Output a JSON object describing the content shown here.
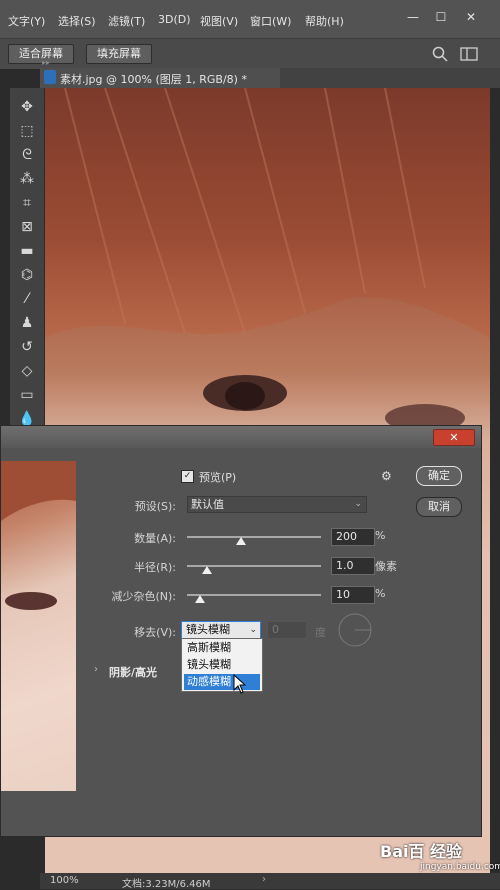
{
  "menu": [
    "文字(Y)",
    "选择(S)",
    "滤镜(T)",
    "3D(D)",
    "视图(V)",
    "窗口(W)",
    "帮助(H)"
  ],
  "window_controls": {
    "minimize": "—",
    "restore": "☐",
    "close": "✕"
  },
  "options_bar": {
    "fit_screen": "适合屏幕",
    "fill_screen": "填充屏幕"
  },
  "document_tab": {
    "title": "素材.jpg @ 100% (图层 1, RGB/8) *",
    "close": "×"
  },
  "dialog": {
    "preview_label": "预览(P)",
    "preview_checked": true,
    "ok_button": "确定",
    "cancel_button": "取消",
    "preset_label": "预设(S):",
    "preset_value": "默认值",
    "amount_label": "数量(A):",
    "amount_value": "200",
    "amount_unit": "%",
    "amount_fraction": 0.4,
    "radius_label": "半径(R):",
    "radius_value": "1.0",
    "radius_unit": "像素",
    "radius_fraction": 0.15,
    "noise_label": "减少杂色(N):",
    "noise_value": "10",
    "noise_unit": "%",
    "noise_fraction": 0.1,
    "remove_label": "移去(V):",
    "remove_value": "镜头模糊",
    "angle_value": "0",
    "angle_unit": "度",
    "shadow_section": "阴影/高光",
    "dropdown_options": [
      "高斯模糊",
      "镜头模糊",
      "动感模糊"
    ],
    "dropdown_highlighted": "动感模糊"
  },
  "status": {
    "zoom": "100%",
    "doc_info": "文档:3.23M/6.46M"
  },
  "watermark": {
    "text": "Bai百 经验",
    "url": "jingyan.baidu.com"
  },
  "colors": {
    "accent_blue": "#2f7fd6",
    "panel_gray": "#535353"
  }
}
